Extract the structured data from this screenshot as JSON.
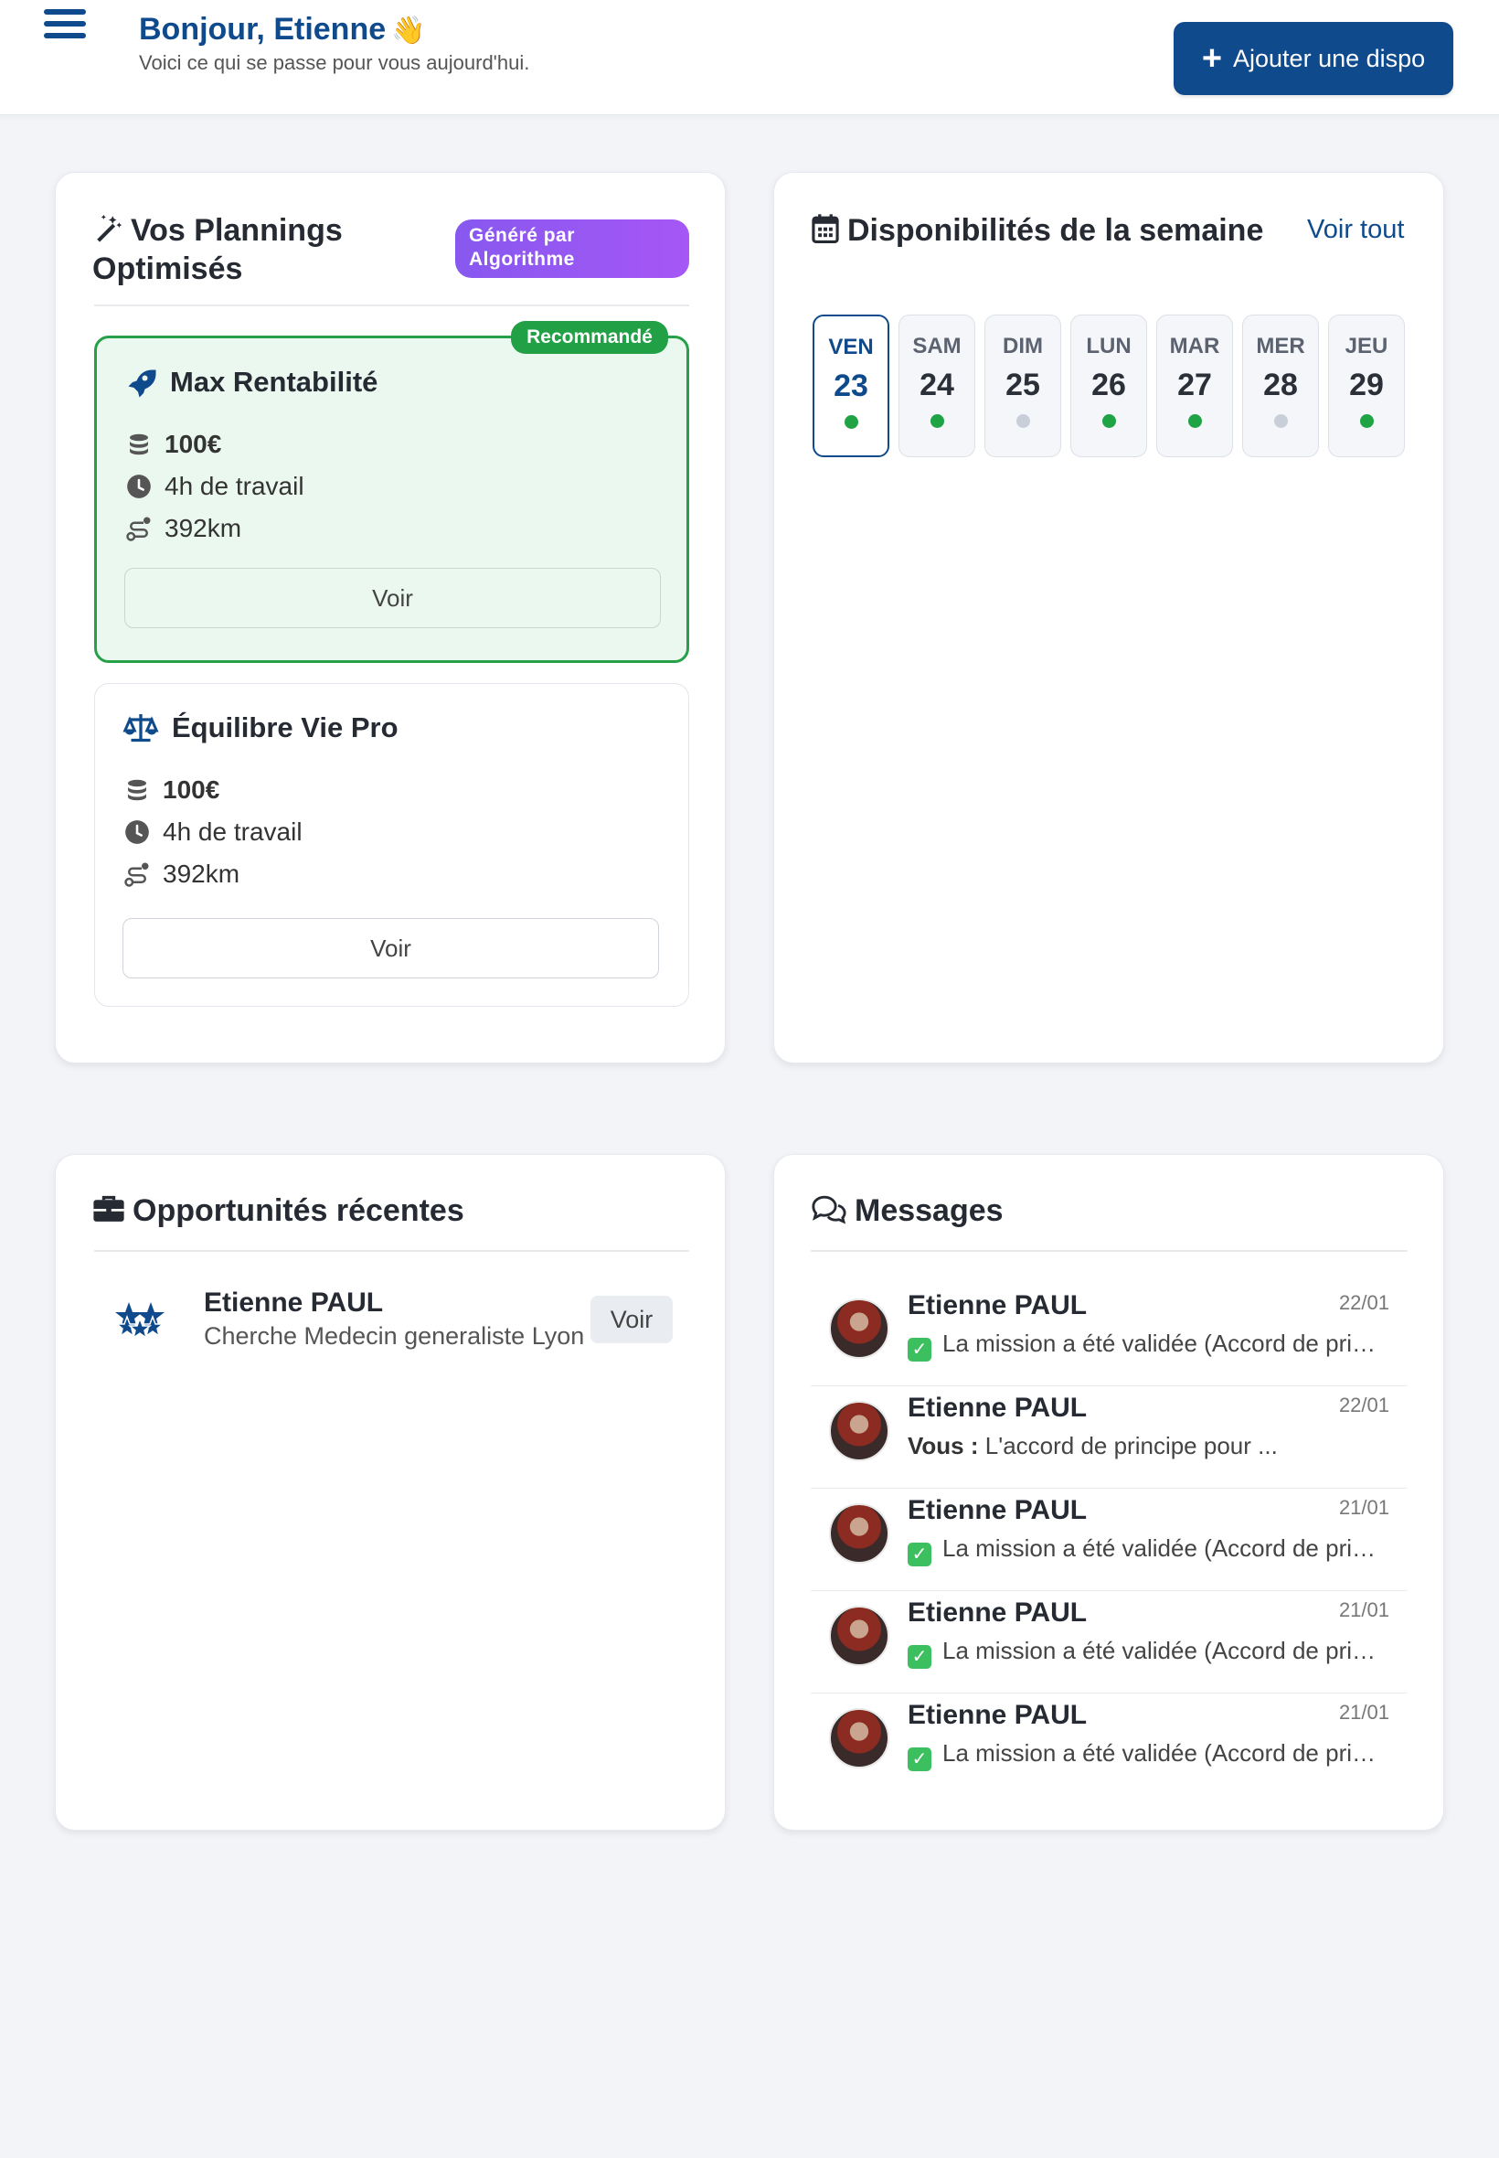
{
  "header": {
    "greeting": "Bonjour, Etienne",
    "wave_emoji": "👋",
    "subtitle": "Voici ce qui se passe pour vous aujourd'hui.",
    "add_button_label": "Ajouter une dispo"
  },
  "plannings": {
    "title_line1": "Vos Plannings",
    "title_line2": "Optimisés",
    "badge_line1": "Généré par",
    "badge_line2": "Algorithme",
    "plans": [
      {
        "name": "Max Rentabilité",
        "recommended_label": "Recommandé",
        "amount": "100€",
        "hours": "4h de travail",
        "distance": "392km",
        "button": "Voir"
      },
      {
        "name": "Équilibre Vie Pro",
        "amount": "100€",
        "hours": "4h de travail",
        "distance": "392km",
        "button": "Voir"
      }
    ]
  },
  "dispos": {
    "title": "Disponibilités de la semaine",
    "see_all": "Voir tout",
    "days": [
      {
        "name": "VEN",
        "num": "23",
        "available": true,
        "active": true
      },
      {
        "name": "SAM",
        "num": "24",
        "available": true,
        "active": false
      },
      {
        "name": "DIM",
        "num": "25",
        "available": false,
        "active": false
      },
      {
        "name": "LUN",
        "num": "26",
        "available": true,
        "active": false
      },
      {
        "name": "MAR",
        "num": "27",
        "available": true,
        "active": false
      },
      {
        "name": "MER",
        "num": "28",
        "available": false,
        "active": false
      },
      {
        "name": "JEU",
        "num": "29",
        "available": true,
        "active": false
      }
    ]
  },
  "opportunities": {
    "title": "Opportunités récentes",
    "items": [
      {
        "name": "Etienne PAUL",
        "description": "Cherche Medecin generaliste Lyon",
        "button": "Voir"
      }
    ]
  },
  "messages": {
    "title": "Messages",
    "items": [
      {
        "name": "Etienne PAUL",
        "date": "22/01",
        "prefix": "",
        "text": "La mission a été validée (Accord de principe)",
        "validated": true
      },
      {
        "name": "Etienne PAUL",
        "date": "22/01",
        "prefix": "Vous :",
        "text": "L'accord de principe pour ...",
        "validated": false
      },
      {
        "name": "Etienne PAUL",
        "date": "21/01",
        "prefix": "",
        "text": "La mission a été validée (Accord de principe)",
        "validated": true
      },
      {
        "name": "Etienne PAUL",
        "date": "21/01",
        "prefix": "",
        "text": "La mission a été validée (Accord de principe)",
        "validated": true
      },
      {
        "name": "Etienne PAUL",
        "date": "21/01",
        "prefix": "",
        "text": "La mission a été validée (Accord de principe)",
        "validated": true
      }
    ]
  },
  "colors": {
    "brand": "#0f4a8c",
    "success": "#22a046",
    "algo_badge": "#9a57f2",
    "background": "#f2f4f8"
  }
}
